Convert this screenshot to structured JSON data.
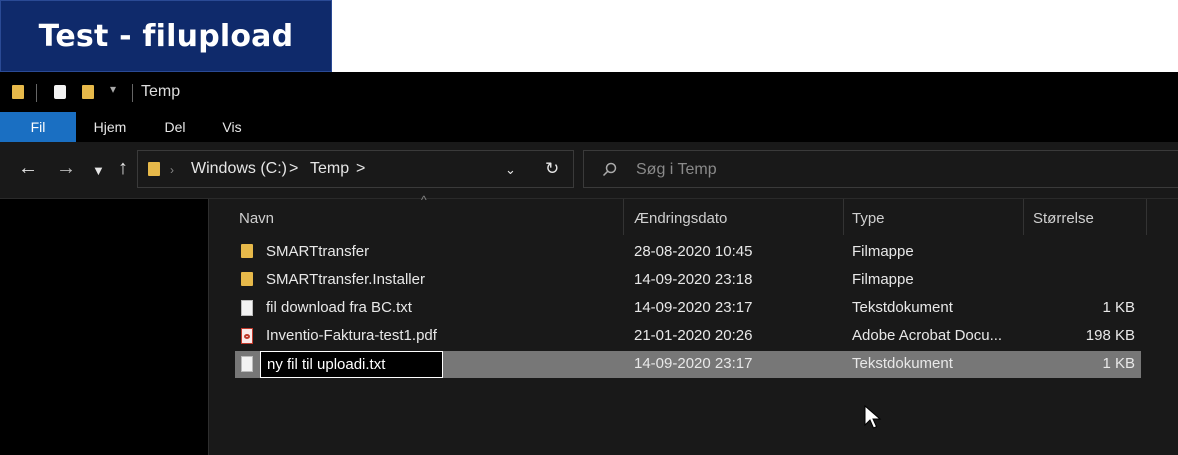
{
  "banner": {
    "title": "Test - filupload"
  },
  "window": {
    "title": "Temp"
  },
  "ribbon": {
    "tabs": [
      "Fil",
      "Hjem",
      "Del",
      "Vis"
    ]
  },
  "address": {
    "drive": "Windows (C:)",
    "folder": "Temp",
    "sep": ">"
  },
  "search": {
    "placeholder": "Søg i Temp"
  },
  "columns": {
    "name": "Navn",
    "date": "Ændringsdato",
    "type": "Type",
    "size": "Størrelse"
  },
  "files": [
    {
      "name": "SMARTtransfer",
      "date": "28-08-2020 10:45",
      "type": "Filmappe",
      "size": "",
      "icon": "folder-icon"
    },
    {
      "name": "SMARTtransfer.Installer",
      "date": "14-09-2020 23:18",
      "type": "Filmappe",
      "size": "",
      "icon": "folder-icon"
    },
    {
      "name": "fil download fra BC.txt",
      "date": "14-09-2020 23:17",
      "type": "Tekstdokument",
      "size": "1 KB",
      "icon": "text-file-icon"
    },
    {
      "name": "Inventio-Faktura-test1.pdf",
      "date": "21-01-2020 20:26",
      "type": "Adobe Acrobat Docu...",
      "size": "198 KB",
      "icon": "pdf-file-icon"
    },
    {
      "name": "ny fil til uploadi.txt",
      "date": "14-09-2020 23:17",
      "type": "Tekstdokument",
      "size": "1 KB",
      "icon": "text-file-icon",
      "renaming": true
    }
  ],
  "colors": {
    "banner": "#0f2a6b",
    "accent_tab": "#1a6fc2",
    "background": "#191919",
    "selection": "#777777"
  }
}
